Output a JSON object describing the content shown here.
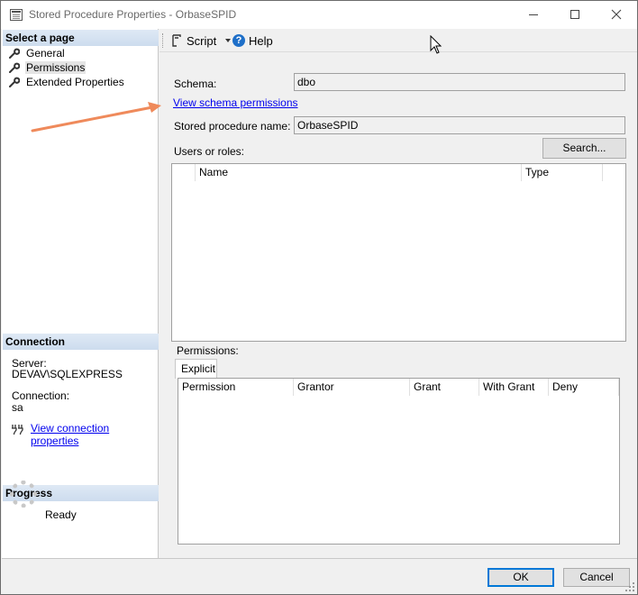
{
  "window": {
    "title": "Stored Procedure Properties - OrbaseSPID",
    "minimize_icon": "minimize-icon",
    "maximize_icon": "maximize-icon",
    "close_icon": "close-icon"
  },
  "sidebar": {
    "select_page_header": "Select a page",
    "items": [
      {
        "label": "General",
        "icon": "wrench-icon",
        "selected": false
      },
      {
        "label": "Permissions",
        "icon": "wrench-icon",
        "selected": true
      },
      {
        "label": "Extended Properties",
        "icon": "wrench-icon",
        "selected": false
      }
    ],
    "connection_header": "Connection",
    "server_label": "Server:",
    "server_value": "DEVAV\\SQLEXPRESS",
    "connection_label": "Connection:",
    "connection_value": "sa",
    "view_connection_link": "View connection properties",
    "progress_header": "Progress",
    "progress_status": "Ready"
  },
  "toolbar": {
    "script_label": "Script",
    "help_label": "Help"
  },
  "permissions_page": {
    "schema_label": "Schema:",
    "schema_value": "dbo",
    "view_schema_link": "View schema permissions",
    "sp_name_label": "Stored procedure name:",
    "sp_name_value": "OrbaseSPID",
    "users_roles_label": "Users or roles:",
    "search_button": "Search...",
    "users_grid_columns": [
      "",
      "Name",
      "Type"
    ],
    "permissions_label": "Permissions:",
    "tab_explicit": "Explicit",
    "permissions_grid_columns": [
      "Permission",
      "Grantor",
      "Grant",
      "With Grant",
      "Deny"
    ]
  },
  "footer": {
    "ok_button": "OK",
    "cancel_button": "Cancel"
  },
  "colors": {
    "accent_link": "#0000ee",
    "annotation_arrow": "#ef8a5b",
    "section_header": "#cddcee",
    "help_icon": "#1e6fc8"
  }
}
